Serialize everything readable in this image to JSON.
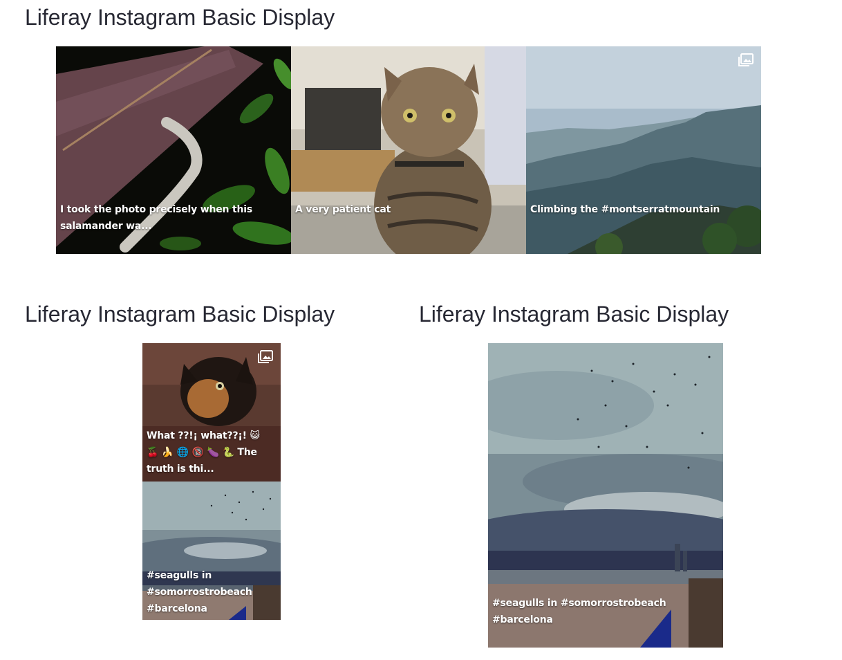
{
  "widgets": [
    {
      "title": "Liferay Instagram Basic Display",
      "posts": [
        {
          "caption": "I took the photo precisely when this salamander wa...",
          "media_type": "image"
        },
        {
          "caption": "A very patient cat",
          "media_type": "image"
        },
        {
          "caption": "Climbing the #montserratmountain",
          "media_type": "carousel",
          "icon": "gallery-icon"
        }
      ]
    },
    {
      "title": "Liferay Instagram Basic Display",
      "posts": [
        {
          "caption": "What ??!¡ what??¡! 😺 🍒 🍌 🌐 🔞 🍆 🐍 The truth is thi...",
          "media_type": "carousel",
          "icon": "gallery-icon"
        },
        {
          "caption": "#seagulls in #somorrostrobeach #barcelona",
          "media_type": "image"
        }
      ]
    },
    {
      "title": "Liferay Instagram Basic Display",
      "posts": [
        {
          "caption": "#seagulls in #somorrostrobeach #barcelona",
          "media_type": "image"
        }
      ]
    }
  ],
  "colors": {
    "title": "#272833",
    "caption": "#ffffff",
    "background": "#ffffff"
  }
}
